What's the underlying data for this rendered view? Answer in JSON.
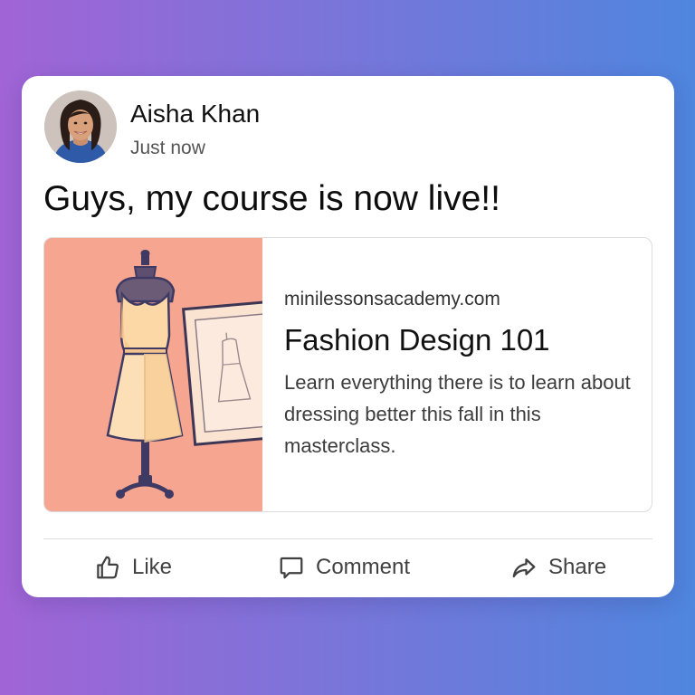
{
  "post": {
    "author_name": "Aisha Khan",
    "timestamp": "Just now",
    "text": "Guys, my course is now live!!"
  },
  "link_preview": {
    "domain": "minilessonsacademy.com",
    "title": "Fashion Design 101",
    "description": "Learn everything there is to learn about dressing better this fall in this masterclass.",
    "image_icon": "dress-form-illustration"
  },
  "actions": {
    "like_label": "Like",
    "comment_label": "Comment",
    "share_label": "Share"
  },
  "icons": {
    "like": "thumbs-up-icon",
    "comment": "speech-bubble-icon",
    "share": "share-arrow-icon"
  },
  "colors": {
    "background_start": "#a164d6",
    "background_end": "#4f86de",
    "card": "#ffffff",
    "preview_image_bg": "#f6a590",
    "text_primary": "#111111",
    "text_secondary": "#555555"
  }
}
